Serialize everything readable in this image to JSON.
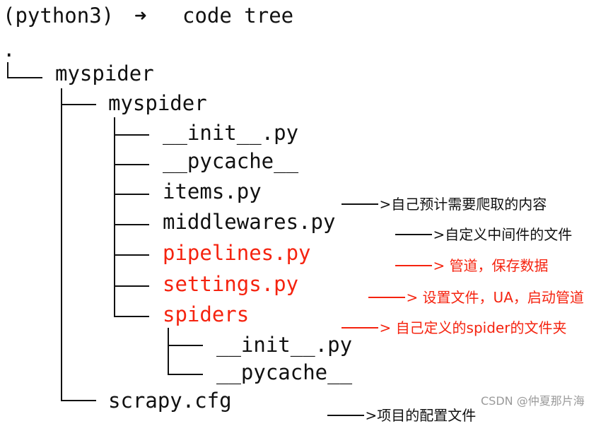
{
  "terminal": {
    "prompt_env": "(python3)",
    "prompt_arrow": "➜",
    "command": "code tree"
  },
  "tree": {
    "root": ".",
    "project_dir": "myspider",
    "package_dir": "myspider",
    "package_files": [
      {
        "name": "__init__.py",
        "highlight": false
      },
      {
        "name": "__pycache__",
        "highlight": false
      },
      {
        "name": "items.py",
        "highlight": false,
        "note": "自己预计需要爬取的内容"
      },
      {
        "name": "middlewares.py",
        "highlight": false,
        "note": "自定义中间件的文件"
      },
      {
        "name": "pipelines.py",
        "highlight": true,
        "note": "管道，保存数据"
      },
      {
        "name": "settings.py",
        "highlight": true,
        "note": "设置文件，UA，启动管道"
      },
      {
        "name": "spiders",
        "highlight": true,
        "note": "自己定义的spider的文件夹"
      }
    ],
    "spiders_files": [
      {
        "name": "__init__.py"
      },
      {
        "name": "__pycache__"
      }
    ],
    "config_file": {
      "name": "scrapy.cfg",
      "note": "项目的配置文件"
    }
  },
  "arrow_head": ">",
  "watermark": "CSDN @仲夏那片海",
  "colors": {
    "text": "#111111",
    "highlight": "#f5230f",
    "watermark": "#9a9a9a"
  }
}
